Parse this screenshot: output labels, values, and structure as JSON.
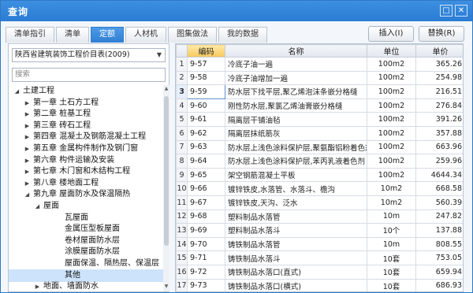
{
  "window": {
    "title": "查询",
    "controls": [
      "□",
      "✕"
    ]
  },
  "tabs": [
    {
      "label": "清单指引",
      "active": false
    },
    {
      "label": "清单",
      "active": false
    },
    {
      "label": "定额",
      "active": true
    },
    {
      "label": "人材机",
      "active": false
    },
    {
      "label": "图集做法",
      "active": false
    },
    {
      "label": "我的数据",
      "active": false
    }
  ],
  "actions": {
    "insert": "插入(I)",
    "replace": "替换(R)"
  },
  "left": {
    "library": "陕西省建筑装饰工程价目表(2009)",
    "search_placeholder": "搜索",
    "tree": [
      {
        "label": "土建工程",
        "level": 0,
        "toggle": "open"
      },
      {
        "label": "第一章 土石方工程",
        "level": 1,
        "toggle": "closed"
      },
      {
        "label": "第二章 桩基工程",
        "level": 1,
        "toggle": "closed"
      },
      {
        "label": "第三章 砖石工程",
        "level": 1,
        "toggle": "closed"
      },
      {
        "label": "第四章 混凝土及钢筋混凝土工程",
        "level": 1,
        "toggle": "closed"
      },
      {
        "label": "第五章 金属构件制作及钢门窗",
        "level": 1,
        "toggle": "closed"
      },
      {
        "label": "第六章 构件运输及安装",
        "level": 1,
        "toggle": "closed"
      },
      {
        "label": "第七章 木门窗和木结构工程",
        "level": 1,
        "toggle": "closed"
      },
      {
        "label": "第八章 楼地面工程",
        "level": 1,
        "toggle": "closed"
      },
      {
        "label": "第九章 屋面防水及保温隔热",
        "level": 1,
        "toggle": "open"
      },
      {
        "label": "屋面",
        "level": 2,
        "toggle": "open"
      },
      {
        "label": "瓦屋面",
        "level": 3,
        "toggle": ""
      },
      {
        "label": "金属压型板屋面",
        "level": 3,
        "toggle": ""
      },
      {
        "label": "卷材屋面防水层",
        "level": 3,
        "toggle": ""
      },
      {
        "label": "涂膜屋面防水层",
        "level": 3,
        "toggle": ""
      },
      {
        "label": "屋面保温、隔热层、保温层",
        "level": 3,
        "toggle": ""
      },
      {
        "label": "其他",
        "level": 3,
        "toggle": "",
        "selected": true
      },
      {
        "label": "地面、墙面防水",
        "level": 2,
        "toggle": "closed"
      }
    ]
  },
  "grid": {
    "columns": [
      "",
      "编码",
      "名称",
      "单位",
      "单价"
    ],
    "current_row": 3,
    "rows": [
      [
        "1",
        "9-57",
        "冷底子油一遍",
        "100m2",
        "365.26"
      ],
      [
        "2",
        "9-58",
        "冷底子油增加一遍",
        "100m2",
        "254.98"
      ],
      [
        "3",
        "9-59",
        "防水层下找平层,聚乙烯泡沫条嵌分格缝",
        "100m2",
        "216.51"
      ],
      [
        "4",
        "9-60",
        "刚性防水层,聚氯乙烯油膏嵌分格缝",
        "100m2",
        "276.84"
      ],
      [
        "5",
        "9-61",
        "隔离层干铺油毡",
        "100m2",
        "391.26"
      ],
      [
        "6",
        "9-62",
        "隔离层抹纸筋灰",
        "100m2",
        "357.88"
      ],
      [
        "7",
        "9-63",
        "防水层上浅色涂料保护层,聚氨酯铝粉着色剂",
        "100m2",
        "663.96"
      ],
      [
        "8",
        "9-64",
        "防水层上浅色涂料保护层,苯丙乳液着色剂",
        "100m2",
        "259.96"
      ],
      [
        "9",
        "9-65",
        "架空钢筋混凝土平板",
        "100m2",
        "4644.34"
      ],
      [
        "10",
        "9-66",
        "镀锌铁皮,水落管、水落斗、檐沟",
        "10m2",
        "668.58"
      ],
      [
        "11",
        "9-67",
        "镀锌铁皮,天沟、泛水",
        "10m2",
        "560.39"
      ],
      [
        "12",
        "9-68",
        "塑料制品水落管",
        "10m",
        "247.82"
      ],
      [
        "13",
        "9-69",
        "塑料制品水落斗",
        "10个",
        "137.88"
      ],
      [
        "14",
        "9-70",
        "铸铁制品水落管",
        "10m",
        "808.55"
      ],
      [
        "15",
        "9-71",
        "铸铁制品水落斗",
        "10套",
        "753.05"
      ],
      [
        "16",
        "9-72",
        "铸铁制品水落口(直式)",
        "10套",
        "659.94"
      ],
      [
        "17",
        "9-73",
        "铸铁制品水落口(横式)",
        "10套",
        "686.93"
      ]
    ]
  }
}
